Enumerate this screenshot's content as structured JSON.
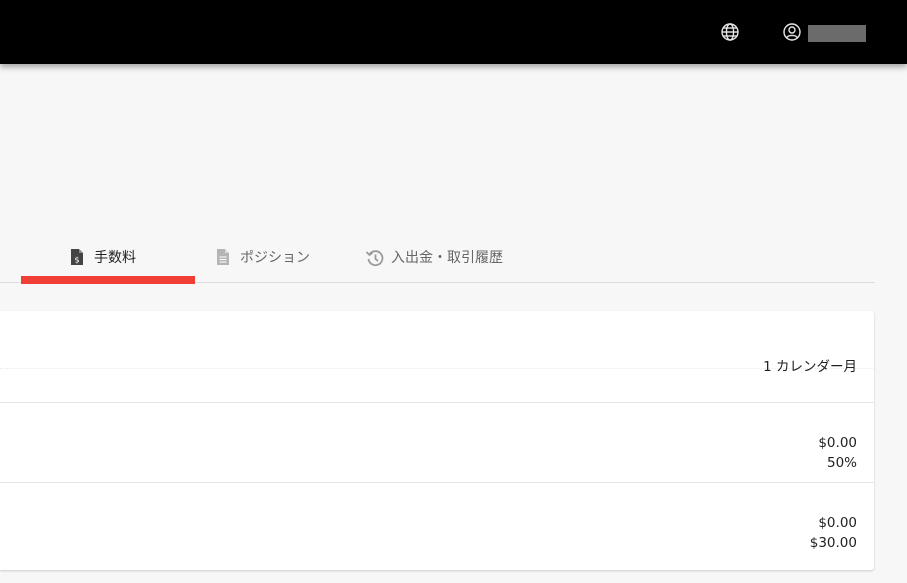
{
  "tabs": [
    {
      "label": "手数料",
      "icon": "fee-document-icon",
      "active": true
    },
    {
      "label": "ポジション",
      "icon": "document-icon",
      "active": false
    },
    {
      "label": "入出金・取引履歴",
      "icon": "history-icon",
      "active": false
    }
  ],
  "colors": {
    "topbar": "#000000",
    "accent": "#ef3e36",
    "background": "#f7f7f7"
  },
  "card": {
    "period": "1 カレンダー月",
    "rows": [
      {
        "value1": "$0.00",
        "value2": "50%"
      },
      {
        "value1": "$0.00",
        "value2": "$30.00"
      }
    ]
  }
}
